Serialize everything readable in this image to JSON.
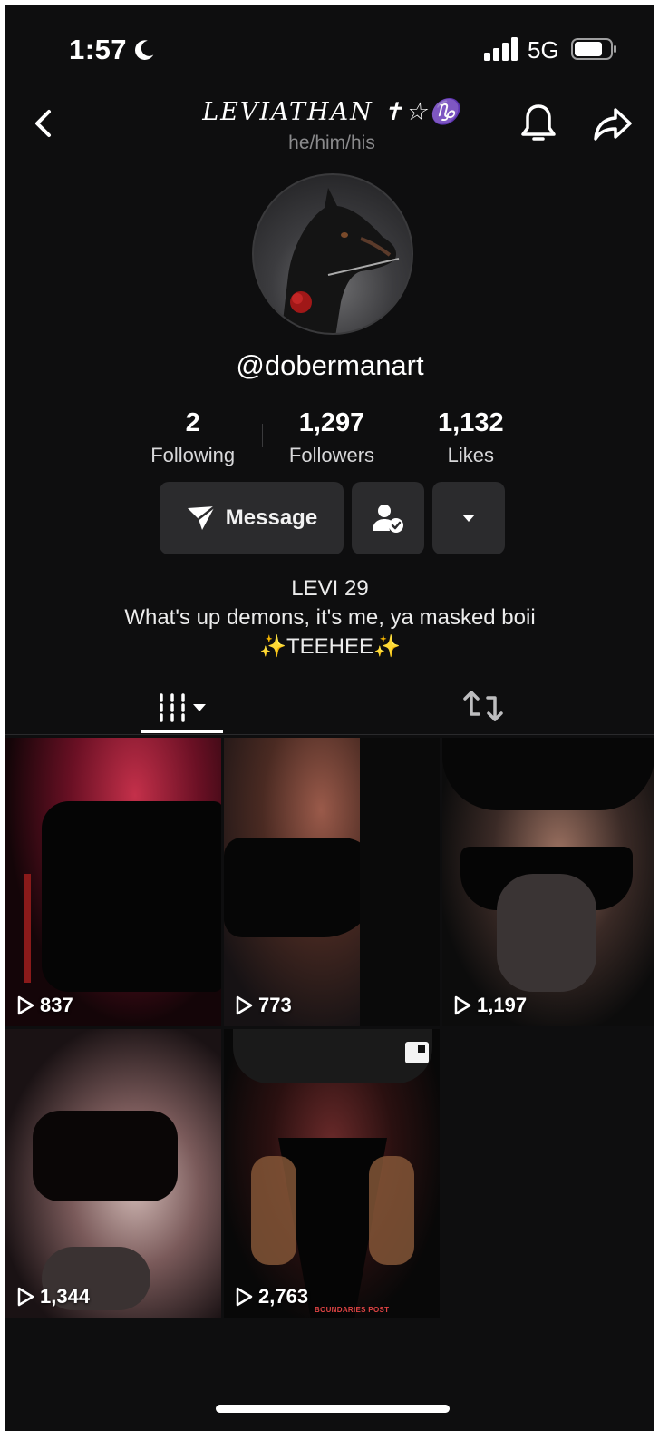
{
  "status_bar": {
    "time": "1:57",
    "network": "5G",
    "icons": [
      "moon-icon",
      "signal-icon",
      "battery-icon"
    ]
  },
  "header": {
    "title": "LEVIATHAN ✝☆♑",
    "pronouns": "he/him/his",
    "icons": [
      "back-icon",
      "bell-icon",
      "share-icon"
    ]
  },
  "profile": {
    "handle": "@dobermanart",
    "stats": [
      {
        "value": "2",
        "label": "Following"
      },
      {
        "value": "1,297",
        "label": "Followers"
      },
      {
        "value": "1,132",
        "label": "Likes"
      }
    ],
    "message_label": "Message",
    "bio": {
      "line1": "LEVI 29",
      "line2": "What's up demons, it's me, ya masked boii",
      "line3": "✨TEEHEE✨"
    }
  },
  "tabs": [
    {
      "name": "videos",
      "icon": "grid-icon",
      "active": true
    },
    {
      "name": "reposts",
      "icon": "repost-icon",
      "active": false
    }
  ],
  "videos": [
    {
      "views": "837"
    },
    {
      "views": "773"
    },
    {
      "views": "1,197"
    },
    {
      "views": "1,344"
    },
    {
      "views": "2,763",
      "pinned": true,
      "caption": "BOUNDARIES POST"
    }
  ],
  "colors": {
    "background": "#0e0e0f",
    "button": "#2b2b2d",
    "muted_text": "#8a8a8c"
  }
}
